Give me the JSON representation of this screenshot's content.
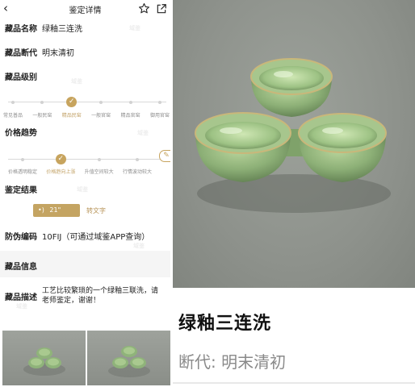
{
  "header": {
    "back_icon": "chevron-left-icon",
    "title": "鉴定详情",
    "favorite_icon": "star-icon",
    "share_icon": "share-icon"
  },
  "fields": {
    "name_label": "藏品名称",
    "name_value": "绿釉三连洗",
    "period_label": "藏品断代",
    "period_value": "明末清初",
    "level_label": "藏品级别",
    "trend_label": "价格趋势",
    "result_label": "鉴定结果",
    "code_label": "防伪编码",
    "code_value": "10FIJ（可通过域鉴APP查询）",
    "info_section": "藏品信息",
    "desc_label": "藏品描述",
    "desc_value": "工艺比较繁琐的一个绿釉三联洗，请老师鉴定，谢谢！"
  },
  "level_scale": {
    "ticks": [
      "常见普品",
      "一般民窑",
      "精品民窑",
      "一般官窑",
      "精品官窑",
      "御用官窑"
    ],
    "selected_index": 2
  },
  "trend_scale": {
    "ticks": [
      "价格透明稳定",
      "价格趋向上涨",
      "升值空间较大",
      "行情波动较大"
    ],
    "selected_index": 1
  },
  "audio": {
    "icon": "sound-wave-icon",
    "duration": "21\"",
    "transcribe_label": "转文字"
  },
  "edit_icon": "pencil-icon",
  "watermark": "域鉴",
  "detail": {
    "title": "绿釉三连洗",
    "period": "断代: 明末清初"
  },
  "colors": {
    "accent": "#c7a45e",
    "glaze_green": "#8fb37a",
    "photo_bg": "#8e928c"
  }
}
